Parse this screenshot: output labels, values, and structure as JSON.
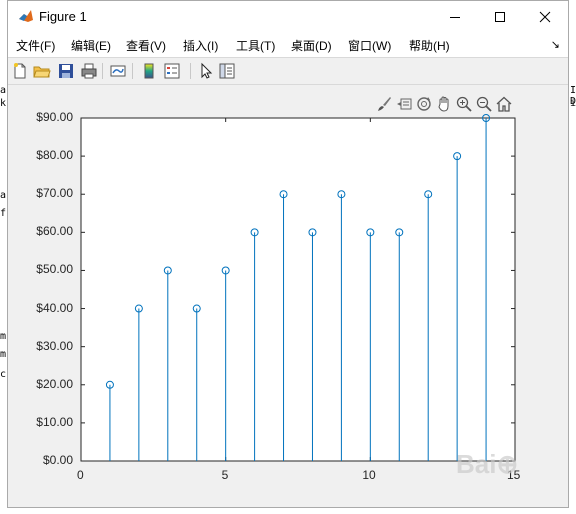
{
  "window": {
    "title": "Figure 1"
  },
  "menu": {
    "items": [
      "文件(F)",
      "编辑(E)",
      "查看(V)",
      "插入(I)",
      "工具(T)",
      "桌面(D)",
      "窗口(W)",
      "帮助(H)"
    ]
  },
  "toolbar": {
    "buttons": [
      "new-figure-icon",
      "open-file-icon",
      "save-icon",
      "print-icon",
      "link-plot-icon",
      "colorbar-icon",
      "legend-icon",
      "pointer-icon",
      "property-inspector-icon"
    ]
  },
  "axes_toolbar": {
    "buttons": [
      "brush-icon",
      "data-tips-icon",
      "rotate-icon",
      "pan-icon",
      "zoom-in-icon",
      "zoom-out-icon",
      "home-icon"
    ]
  },
  "background_text": {
    "left": [
      "a",
      "ks",
      "a",
      "f",
      "m",
      "m",
      "c"
    ],
    "right": [
      "I D",
      "is"
    ]
  },
  "chart_data": {
    "type": "stem",
    "x": [
      1,
      2,
      3,
      4,
      5,
      6,
      7,
      8,
      9,
      10,
      11,
      12,
      13,
      14
    ],
    "values": [
      20,
      40,
      50,
      40,
      50,
      60,
      70,
      60,
      70,
      60,
      60,
      70,
      80,
      90
    ],
    "xlim": [
      0,
      15
    ],
    "ylim": [
      0,
      90
    ],
    "xticks": [
      "0",
      "5",
      "10",
      "15"
    ],
    "yticks": [
      "$0.00",
      "$10.00",
      "$20.00",
      "$30.00",
      "$40.00",
      "$50.00",
      "$60.00",
      "$70.00",
      "$80.00",
      "$90.00"
    ],
    "color": "#0072bd",
    "marker": "circle",
    "grid": false
  }
}
